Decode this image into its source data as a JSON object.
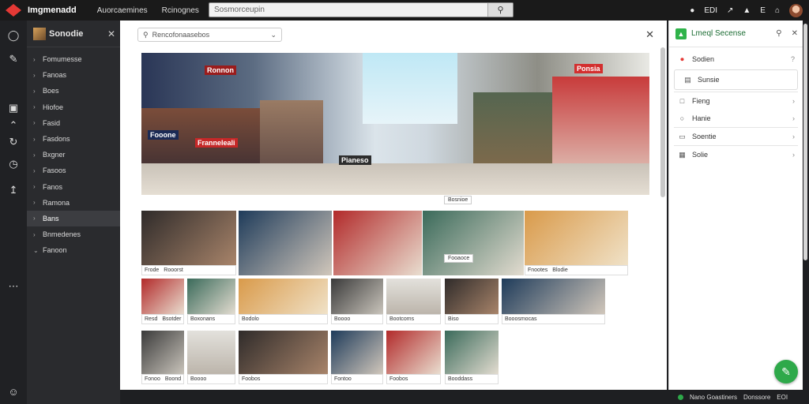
{
  "topbar": {
    "brand": "Imgmenadd",
    "nav": [
      "Auorcaemines",
      "Rcinognes"
    ],
    "search_placeholder": "Sosmorceupin",
    "right_items": [
      "EDI",
      "B",
      "E"
    ]
  },
  "rail": {
    "icons": [
      "home-icon",
      "tool-icon",
      "screen-icon",
      "up-icon",
      "refresh-icon",
      "clock-icon",
      "export-icon",
      "more-icon",
      "user-icon"
    ]
  },
  "sidebar": {
    "title": "Sonodie",
    "items": [
      {
        "label": "Fomumesse"
      },
      {
        "label": "Fanoas"
      },
      {
        "label": "Boes"
      },
      {
        "label": "Hiofoe"
      },
      {
        "label": "Fasid"
      },
      {
        "label": "Fasdons"
      },
      {
        "label": "Bxgner"
      },
      {
        "label": "Fasoos"
      },
      {
        "label": "Fanos"
      },
      {
        "label": "Ramona"
      },
      {
        "label": "Bans",
        "active": true
      },
      {
        "label": "Bnmedenes"
      },
      {
        "label": "Fanoon"
      }
    ]
  },
  "panel": {
    "search_value": "Rencofonaasebos",
    "hero_signs": [
      "Fooone",
      "Franneleali",
      "Ronnon",
      "Pianeso",
      "Ponsia"
    ],
    "row2": [
      {
        "cap": [
          "Frode",
          "Rooorst"
        ]
      },
      {
        "cap": []
      },
      {
        "cap": []
      },
      {
        "cap": []
      },
      {
        "cap": [
          "Fnootes",
          "Blodie"
        ]
      }
    ],
    "row2_float_labels": [
      "Bosnioe",
      "Fooaoce"
    ],
    "row3": [
      {
        "cap": [
          "Resd",
          "Bsotder"
        ]
      },
      {
        "cap": [
          "Boxonans"
        ]
      },
      {
        "cap": [
          "Bodolo"
        ]
      },
      {
        "cap": [
          "Boooo"
        ]
      },
      {
        "cap": [
          "Bootcoms"
        ]
      },
      {
        "cap": [
          "Biso"
        ]
      },
      {
        "cap": [
          "Booosmocas"
        ]
      }
    ],
    "row4": [
      {
        "cap": [
          "Fonoo",
          "Boond"
        ]
      },
      {
        "cap": [
          "Boooo"
        ]
      },
      {
        "cap": [
          "Foobos"
        ]
      },
      {
        "cap": [
          "Fontoo"
        ]
      },
      {
        "cap": [
          "Foobos"
        ]
      },
      {
        "cap": [
          "Booddass"
        ]
      }
    ]
  },
  "right_panel": {
    "title": "Lmeql Secense",
    "items": [
      {
        "icon": "record-icon",
        "label": "Sodien",
        "chevron": "?"
      },
      {
        "icon": "doc-icon",
        "label": "Sunsie",
        "chevron": ""
      },
      {
        "icon": "box-icon",
        "label": "Fieng",
        "chevron": "›"
      },
      {
        "icon": "circle-icon",
        "label": "Hanie",
        "chevron": "›"
      },
      {
        "icon": "list-icon",
        "label": "Soentie",
        "chevron": "›"
      },
      {
        "icon": "grid-icon",
        "label": "Solie",
        "chevron": "›"
      }
    ]
  },
  "status": {
    "items": [
      "Nano Goastiners",
      "Donssore",
      "EOI"
    ]
  }
}
